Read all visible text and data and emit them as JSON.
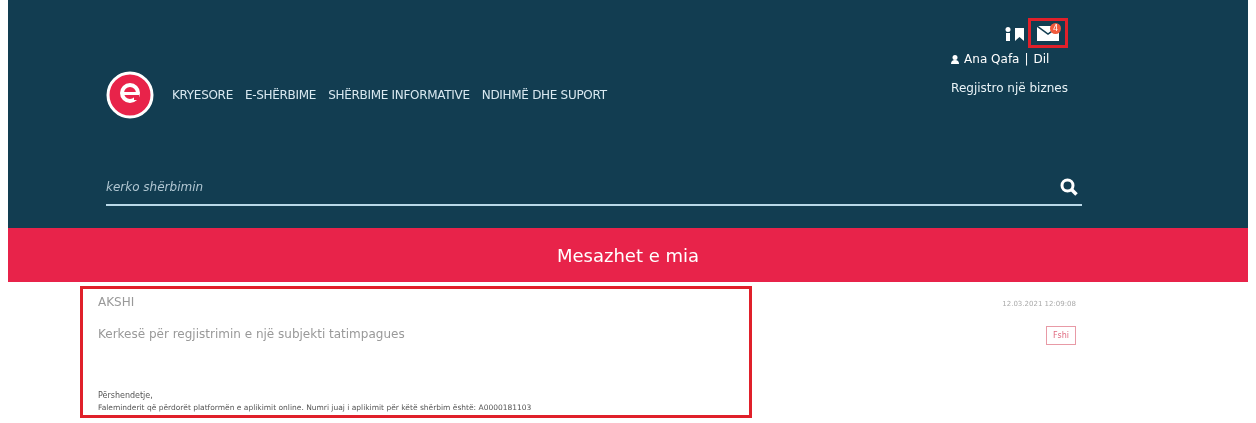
{
  "nav": [
    "KRYESORE",
    "E-SHËRBIME",
    "SHËRBIME INFORMATIVE",
    "NDIHMË DHE SUPORT"
  ],
  "notifications": {
    "count": "4"
  },
  "user": {
    "name": "Ana Qafa",
    "separator": "|",
    "logout": "Dil"
  },
  "register_link": "Regjistro një biznes",
  "search": {
    "placeholder": "kerko shërbimin"
  },
  "page_title": "Mesazhet e mia",
  "messages": [
    {
      "sender": "AKSHI",
      "subject": "Kerkesë për regjistrimin e një subjekti tatimpagues",
      "greeting": "Përshendetje,",
      "body": "Faleminderit që përdorët platformën e aplikimit online. Numri juaj i aplikimit për këtë shërbim është: A0000181103",
      "date": "12.03.2021 12:09:08",
      "delete": "Fshi"
    }
  ]
}
